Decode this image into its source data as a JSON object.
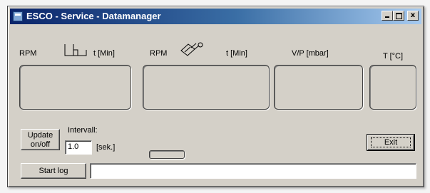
{
  "window": {
    "title": "ESCO - Service - Datamanager",
    "title_icon": "app-icon",
    "controls": [
      "minimize-icon",
      "maximize-icon",
      "close-icon"
    ],
    "close_glyph": "x"
  },
  "headers": {
    "rpm1": "RPM",
    "tmin1": "t [Min]",
    "rpm2": "RPM",
    "tmin2": "t [Min]",
    "vp": "V/P [mbar]",
    "temp": "T [°C]"
  },
  "icons": {
    "stirrer": "stirrer-icon",
    "rotary_evaporator": "rotary-flask-icon"
  },
  "controls": {
    "update_line1": "Update",
    "update_line2": "on/off",
    "interval_label": "Intervall:",
    "interval_value": "1.0",
    "interval_unit": "[sek.]",
    "exit_label": "Exit",
    "start_log_label": "Start log",
    "log_value": ""
  },
  "colors": {
    "face": "#d4d0c8",
    "title_start": "#0a246a",
    "title_end": "#a6caf0"
  }
}
